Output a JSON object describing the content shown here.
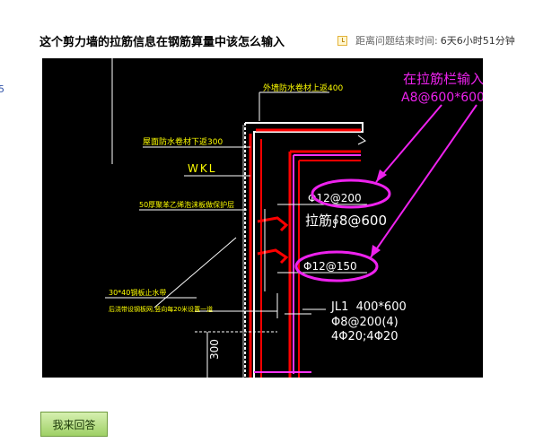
{
  "question": {
    "title": "这个剪力墙的拉筋信息在钢筋算量中该怎么输入"
  },
  "countdown": {
    "icon": "clock-icon",
    "label": "距离问题结束时间:",
    "value": "6天6小时51分钟"
  },
  "side_mark": "5",
  "figure": {
    "annotation_line1": "在拉筋栏输入",
    "annotation_line2": "A8@600*600",
    "label_top": "外墙防水卷材上返400",
    "label_left1": "屋面防水卷材下返300",
    "label_wkl": "WKL",
    "label_left2": "50厚聚苯乙烯泡沫板做保护层",
    "rebar1": "Φ12@200",
    "tie_label": "拉筋∮8@600",
    "rebar2": "Φ12@150",
    "note1": "30*40钢板止水带",
    "note2": "后浇带设钢板网,竖向每20米设置一道",
    "jl_title": "JL1  400*600",
    "jl_line2": "Φ8@200(4)",
    "jl_line3": "4Φ20;4Φ20",
    "dimension": "300",
    "colors": {
      "background": "#000000",
      "wall": "#ffffff",
      "rebar": "#ff0000",
      "stirrup": "#ff33ff",
      "highlight": "#ee22ee",
      "yellow_text": "#ffff00",
      "white_text": "#ffffff"
    }
  },
  "answer_button": {
    "label": "我来回答"
  }
}
